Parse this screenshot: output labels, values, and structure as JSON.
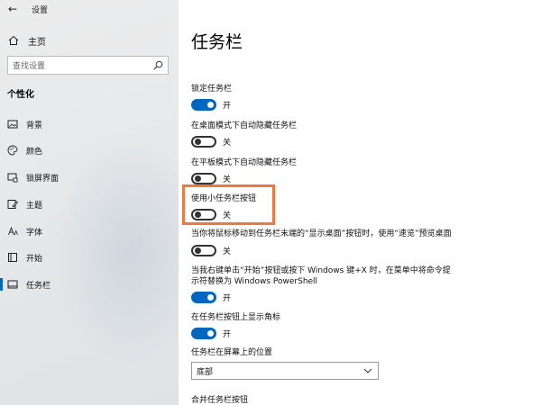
{
  "window": {
    "title": "设置"
  },
  "sidebar": {
    "home_label": "主页",
    "search_placeholder": "查找设置",
    "section_title": "个性化",
    "items": [
      {
        "label": "背景",
        "icon": "image-icon"
      },
      {
        "label": "颜色",
        "icon": "palette-icon"
      },
      {
        "label": "锁屏界面",
        "icon": "lock-screen-icon"
      },
      {
        "label": "主题",
        "icon": "theme-brush-icon"
      },
      {
        "label": "字体",
        "icon": "font-icon"
      },
      {
        "label": "开始",
        "icon": "start-icon"
      },
      {
        "label": "任务栏",
        "icon": "taskbar-icon",
        "active": true
      }
    ]
  },
  "main": {
    "title": "任务栏",
    "settings": [
      {
        "label": "锁定任务栏",
        "state": "开"
      },
      {
        "label": "在桌面模式下自动隐藏任务栏",
        "state": "关"
      },
      {
        "label": "在平板模式下自动隐藏任务栏",
        "state": "关"
      },
      {
        "label": "使用小任务栏按钮",
        "state": "关"
      },
      {
        "label": "当你将鼠标移动到任务栏末端的“显示桌面”按钮时，使用“速览”预览桌面",
        "state": "关"
      },
      {
        "label_line1": "当我右键单击“开始”按钮或按下 Windows 键+X 时，在菜单中将命令提",
        "label_line2": "示符替换为 Windows PowerShell",
        "state": "开"
      },
      {
        "label": "在任务栏按钮上显示角标",
        "state": "开"
      }
    ],
    "position": {
      "label": "任务栏在屏幕上的位置",
      "value": "底部"
    },
    "combine_label": "合并任务栏按钮"
  },
  "colors": {
    "accent": "#0067c0",
    "highlight": "#ec7a3c"
  }
}
